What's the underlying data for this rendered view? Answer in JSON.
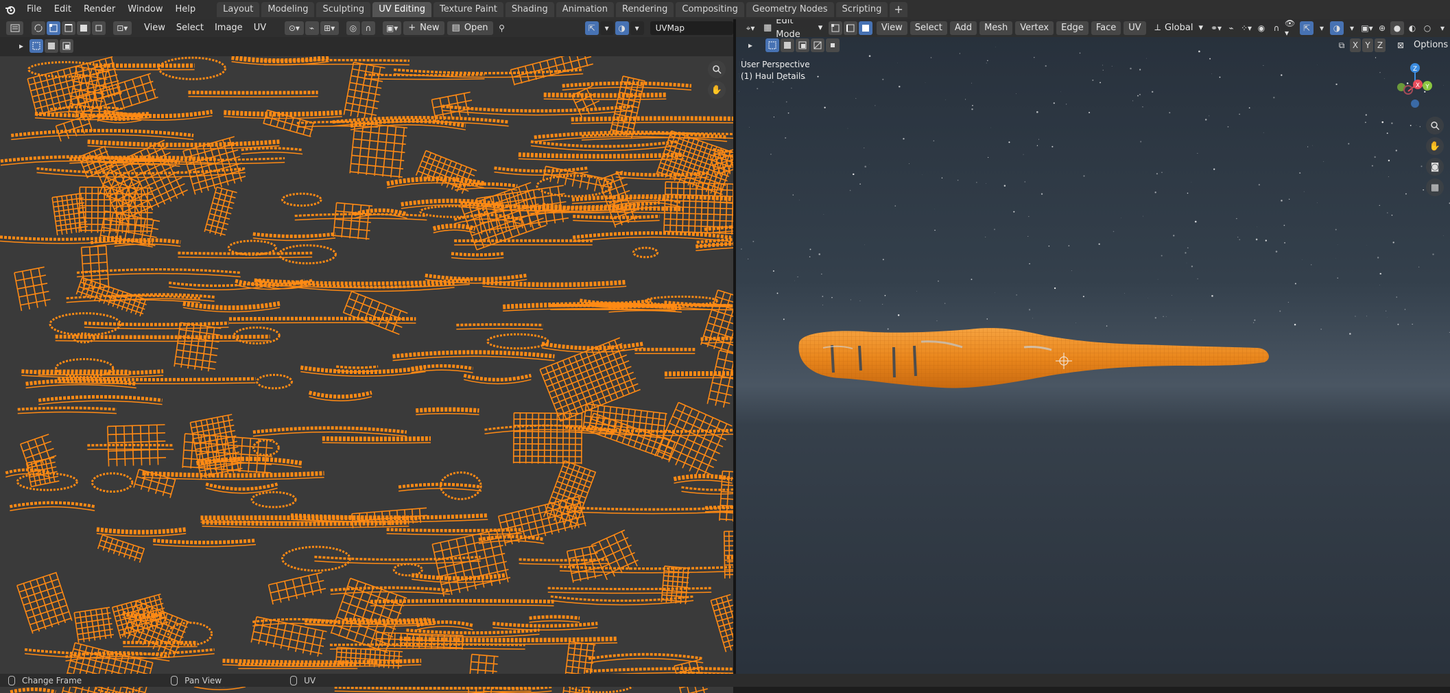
{
  "topbar": {
    "menus": [
      "File",
      "Edit",
      "Render",
      "Window",
      "Help"
    ],
    "tabs": [
      "Layout",
      "Modeling",
      "Sculpting",
      "UV Editing",
      "Texture Paint",
      "Shading",
      "Animation",
      "Rendering",
      "Compositing",
      "Geometry Nodes",
      "Scripting"
    ],
    "active_tab": "UV Editing",
    "add_tab": "+"
  },
  "uv_editor": {
    "menus": [
      "View",
      "Select",
      "Image",
      "UV"
    ],
    "new_label": "New",
    "open_label": "Open",
    "uv_map": "UVMap",
    "accent": "#ff8a14",
    "background": "#3a3a3a"
  },
  "viewport": {
    "mode": "Edit Mode",
    "menus": [
      "View",
      "Select",
      "Add",
      "Mesh",
      "Vertex",
      "Edge",
      "Face",
      "UV"
    ],
    "transform_orientation": "Global",
    "options_label": "Options",
    "axes": [
      "X",
      "Y",
      "Z"
    ],
    "gizmo_labels": {
      "z": "Z",
      "x": "X",
      "y": "Y"
    },
    "overlay_line1": "User Perspective",
    "overlay_line2": "(1) Haul Details",
    "object_color": "#f08a1c"
  },
  "statusbar": {
    "items": [
      "Change Frame",
      "Pan View",
      "UV"
    ]
  }
}
